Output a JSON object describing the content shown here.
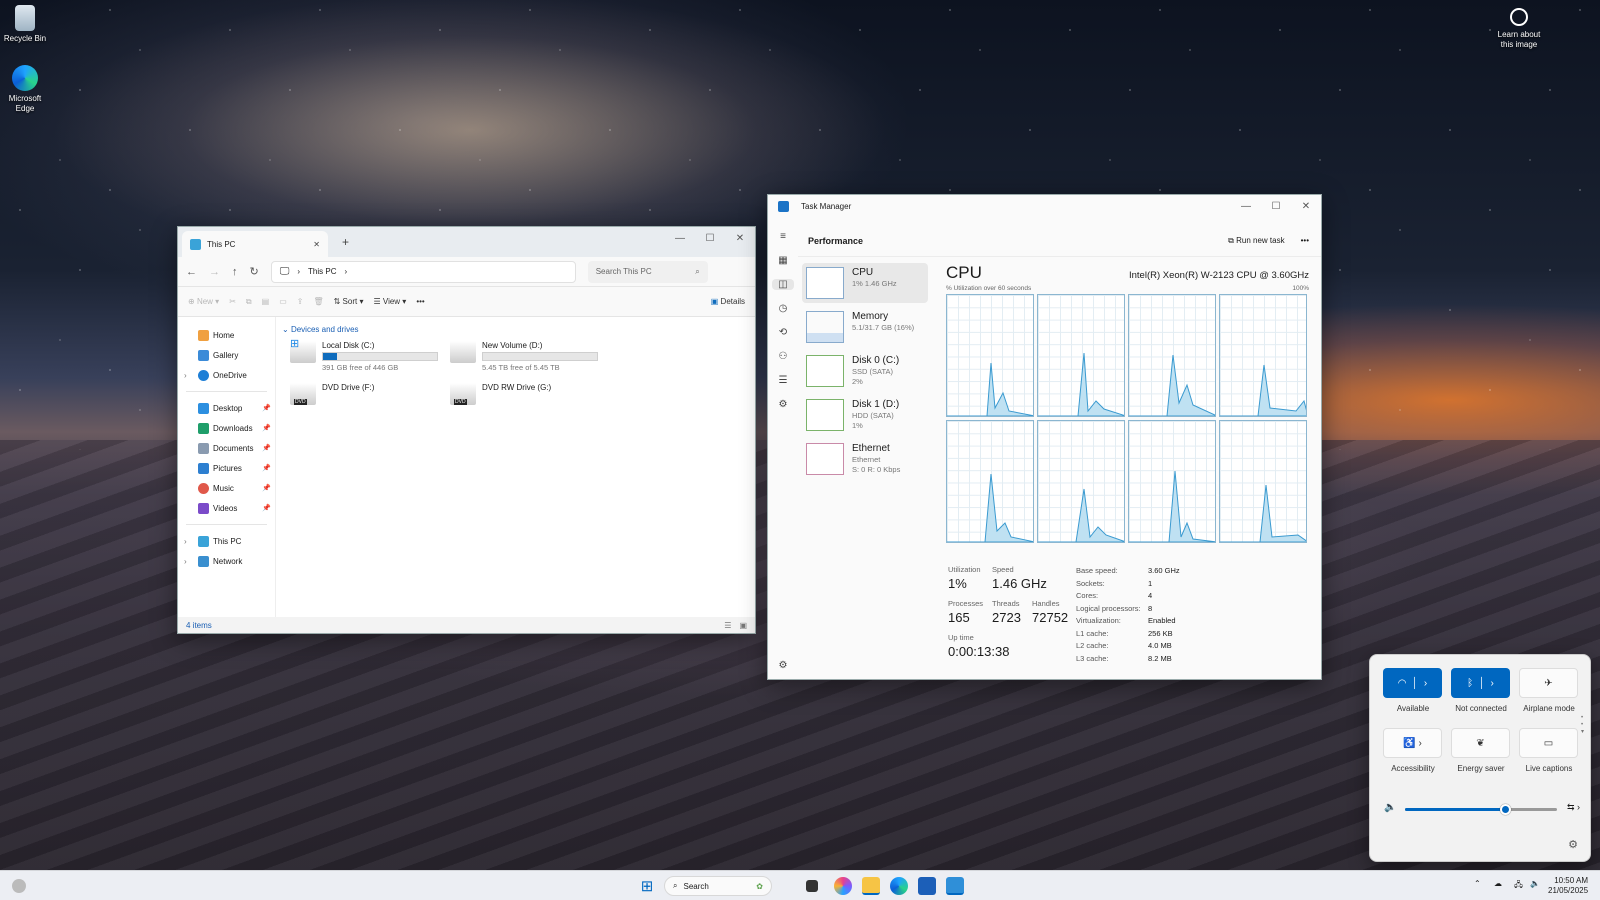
{
  "desktop": {
    "icons": [
      {
        "label": "Recycle Bin"
      },
      {
        "label": "Microsoft Edge"
      }
    ],
    "learn": "Learn about this image"
  },
  "explorer": {
    "tab_title": "This PC",
    "tab_close": "✕",
    "tab_add": "+",
    "breadcrumb": [
      "This PC"
    ],
    "search_placeholder": "Search This PC",
    "cmd": {
      "new": "New",
      "sort": "Sort",
      "view": "View",
      "more": "•••",
      "details": "Details"
    },
    "nav": [
      {
        "label": "Home"
      },
      {
        "label": "Gallery"
      },
      {
        "label": "OneDrive"
      }
    ],
    "quick": [
      {
        "label": "Desktop"
      },
      {
        "label": "Downloads"
      },
      {
        "label": "Documents"
      },
      {
        "label": "Pictures"
      },
      {
        "label": "Music"
      },
      {
        "label": "Videos"
      }
    ],
    "tree": [
      {
        "label": "This PC"
      },
      {
        "label": "Network"
      }
    ],
    "section": "Devices and drives",
    "drives": [
      {
        "name": "Local Disk (C:)",
        "free": "391 GB free of 446 GB",
        "used_fraction": 0.12
      },
      {
        "name": "New Volume (D:)",
        "free": "5.45 TB free of 5.45 TB",
        "used_fraction": 0.0
      },
      {
        "name": "DVD Drive (F:)",
        "badge": "DVD"
      },
      {
        "name": "DVD RW Drive (G:)",
        "badge": "DVD"
      }
    ],
    "status": "4 items"
  },
  "taskmanager": {
    "title": "Task Manager",
    "page": "Performance",
    "run_new_task": "Run new task",
    "more": "•••",
    "side": [
      {
        "name": "CPU",
        "sub": "1% 1.46 GHz"
      },
      {
        "name": "Memory",
        "sub": "5.1/31.7 GB (16%)"
      },
      {
        "name": "Disk 0 (C:)",
        "sub": "SSD (SATA)",
        "sub2": "2%"
      },
      {
        "name": "Disk 1 (D:)",
        "sub": "HDD (SATA)",
        "sub2": "1%"
      },
      {
        "name": "Ethernet",
        "sub": "Ethernet",
        "sub2": "S: 0 R: 0 Kbps"
      }
    ],
    "cpu_title": "CPU",
    "cpu_model": "Intel(R) Xeon(R) W-2123 CPU @ 3.60GHz",
    "util_label": "% Utilization over 60 seconds",
    "util_max": "100%",
    "stats": {
      "utilization_label": "Utilization",
      "utilization": "1%",
      "speed_label": "Speed",
      "speed": "1.46 GHz",
      "processes_label": "Processes",
      "processes": "165",
      "threads_label": "Threads",
      "threads": "2723",
      "handles_label": "Handles",
      "handles": "72752",
      "uptime_label": "Up time",
      "uptime": "0:00:13:38"
    },
    "details": [
      {
        "k": "Base speed:",
        "v": "3.60 GHz"
      },
      {
        "k": "Sockets:",
        "v": "1"
      },
      {
        "k": "Cores:",
        "v": "4"
      },
      {
        "k": "Logical processors:",
        "v": "8"
      },
      {
        "k": "Virtualization:",
        "v": "Enabled"
      },
      {
        "k": "L1 cache:",
        "v": "256 KB"
      },
      {
        "k": "L2 cache:",
        "v": "4.0 MB"
      },
      {
        "k": "L3 cache:",
        "v": "8.2 MB"
      }
    ]
  },
  "quick_settings": {
    "tiles": [
      {
        "label": "Available"
      },
      {
        "label": "Not connected"
      },
      {
        "label": "Airplane mode"
      },
      {
        "label": "Accessibility"
      },
      {
        "label": "Energy saver"
      },
      {
        "label": "Live captions"
      }
    ],
    "volume": 0.66
  },
  "taskbar": {
    "search": "Search",
    "time": "10:50 AM",
    "date": "21/05/2025"
  }
}
